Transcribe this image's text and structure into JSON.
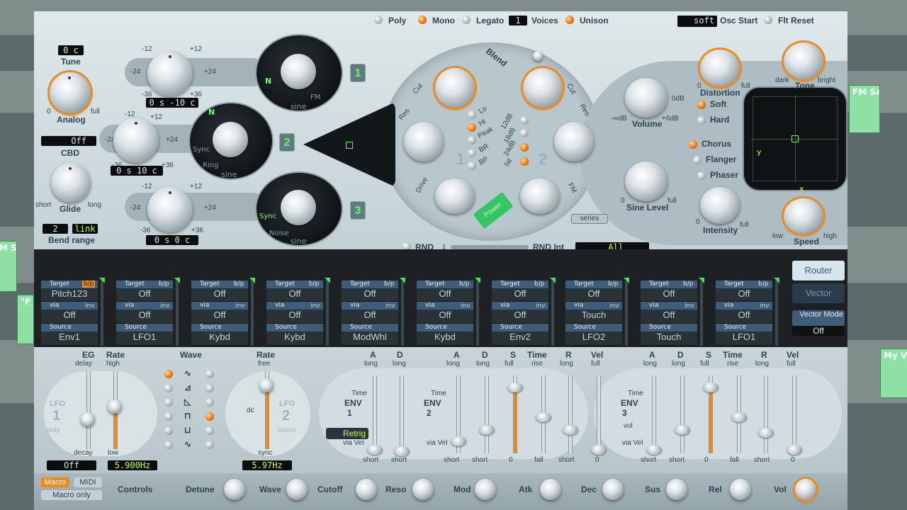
{
  "daw": {
    "regions": [
      {
        "label": "FM Sa"
      },
      {
        "label": "M Sa"
      },
      {
        "label": "\"F"
      },
      {
        "label": "My V"
      }
    ]
  },
  "header": {
    "poly": "Poly",
    "mono": "Mono",
    "legato": "Legato",
    "voices_value": "1",
    "voices": "Voices",
    "unison": "Unison",
    "osc_start_value": "soft",
    "osc_start": "Osc Start",
    "flt_reset": "Flt Reset"
  },
  "global": {
    "tune_value": "0 c",
    "tune": "Tune",
    "analog": "Analog",
    "analog_min": "0",
    "analog_max": "full",
    "cbd_value": "Off",
    "cbd": "CBD",
    "glide": "Glide",
    "glide_min": "short",
    "glide_max": "long",
    "bend_down": "2",
    "bend_link": "link",
    "bend_range": "Bend range"
  },
  "osc": {
    "scale": {
      "m12": "-12",
      "p12": "+12",
      "m24": "-24",
      "p24": "+24",
      "m36": "-36",
      "p36": "+36"
    },
    "o1": {
      "number": "1",
      "tune": "0 s -10 c",
      "wave": "sine",
      "fm": "FM"
    },
    "o2": {
      "number": "2",
      "tune": "0 s  10 c",
      "wave": "sine",
      "sync": "Sync",
      "ring": "Ring"
    },
    "o3": {
      "number": "3",
      "tune": "0 s    0 c",
      "wave": "sine",
      "sync": "Sync",
      "noise": "Noise"
    }
  },
  "filter": {
    "blend": "Blend",
    "cut1": "Cut",
    "res1": "Res",
    "drive": "Drive",
    "cut2": "Cut",
    "res2": "Res",
    "fm": "FM",
    "types": [
      "Lo",
      "Hi",
      "Peak",
      "BR",
      "BP"
    ],
    "slopes": [
      "12dB",
      "18dB",
      "24dB",
      "fat"
    ],
    "series": "series",
    "power": "Power",
    "f1": "1",
    "f2": "2"
  },
  "output": {
    "volume": "Volume",
    "vol_min": "-∞dB",
    "vol_max": "+6dB",
    "vol_zero": "0dB",
    "sine_level": "Sine Level",
    "sine_min": "0",
    "sine_max": "full",
    "distortion": "Distortion",
    "dist_min": "0",
    "dist_max": "full",
    "soft": "Soft",
    "hard": "Hard",
    "tone": "Tone",
    "tone_min": "dark",
    "tone_max": "bright",
    "chorus": "Chorus",
    "flanger": "Flanger",
    "phaser": "Phaser",
    "intensity": "Intensity",
    "int_min": "0",
    "int_max": "full",
    "speed": "Speed",
    "speed_min": "low",
    "speed_max": "high",
    "vector_x": "x",
    "vector_y": "y"
  },
  "rnd": {
    "rnd": "RND",
    "rnd_one": "1",
    "rnd_int": "RND Int",
    "target": "All"
  },
  "router": {
    "tab_router": "Router",
    "tab_vector": "Vector",
    "vector_mode": "Vector Mode",
    "vector_mode_value": "Off",
    "slots": [
      {
        "target": "Pitch123",
        "via": "Off",
        "source": "Env1"
      },
      {
        "target": "Off",
        "via": "Off",
        "source": "LFO1"
      },
      {
        "target": "Off",
        "via": "Off",
        "source": "Kybd"
      },
      {
        "target": "Off",
        "via": "Off",
        "source": "Kybd"
      },
      {
        "target": "Off",
        "via": "Off",
        "source": "ModWhl"
      },
      {
        "target": "Off",
        "via": "Off",
        "source": "Kybd"
      },
      {
        "target": "Off",
        "via": "Off",
        "source": "Env2"
      },
      {
        "target": "Off",
        "via": "Touch",
        "source": "LFO2"
      },
      {
        "target": "Off",
        "via": "Off",
        "source": "Touch"
      },
      {
        "target": "Off",
        "via": "Off",
        "source": "LFO1"
      }
    ],
    "hdr_target": "Target",
    "hdr_bp": "b/p",
    "hdr_via": "via",
    "hdr_inv": "inv",
    "hdr_source": "Source"
  },
  "lfo": {
    "eg": "EG",
    "eg_sub": "delay",
    "rate": "Rate",
    "rate_sub": "high",
    "decay": "decay",
    "low": "low",
    "lfo": "LFO",
    "lfo1_num": "1",
    "lfo1_sub": "poly",
    "val1": "Off",
    "val2": "5.900Hz",
    "wave": "Wave",
    "rate2": "Rate",
    "rate2_sub": "free",
    "lfo2_num": "2",
    "lfo2_sub": "mono",
    "dc": "dc",
    "sync": "sync",
    "val3": "5.97Hz"
  },
  "env": {
    "a": "A",
    "d": "D",
    "s": "S",
    "r": "R",
    "vel": "Vel",
    "time": "Time",
    "long": "long",
    "full": "full",
    "rise": "rise",
    "fall": "fall",
    "short": "short",
    "zero": "0",
    "env": "ENV",
    "e1": "1",
    "e2": "2",
    "e3": "3",
    "vol": "vol",
    "retrig": "Retrig",
    "via_vel": "via Vel"
  },
  "controls": {
    "macro": "Macro",
    "midi": "MIDI",
    "macro_only": "Macro only",
    "controls": "Controls",
    "knobs": [
      "Detune",
      "Wave",
      "Cutoff",
      "Reso",
      "Mod",
      "Atk",
      "Dec",
      "Sus",
      "Rel",
      "Vol"
    ]
  }
}
